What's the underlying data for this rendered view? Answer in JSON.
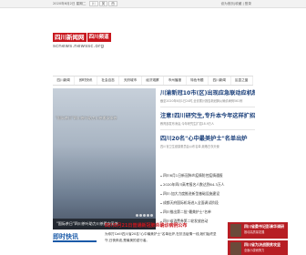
{
  "topbar": {
    "date": "2020年6月2日 星期二",
    "tabs": [
      "川",
      "英",
      "西"
    ],
    "right_text": "设为首页|收藏 | 登录"
  },
  "logo": {
    "badge": "四川新闻网",
    "badge2": "四川频道",
    "domain": "scnews.newssc.org"
  },
  "nav": {
    "items": [
      "四川新闻",
      "即时快讯",
      "社会百态",
      "天府城市",
      "经济观察",
      "市州播报",
      "特色专题",
      "四川新闻",
      "区县之窗"
    ]
  },
  "slider": {
    "caption_top": "\"国际茶日\"四川茶叶助力川茶雅安采茶",
    "caption_bottom": "\"国际茶日\"四川茶叶助力川茶雅安采茶",
    "dots": 5
  },
  "headlines": [
    {
      "title": "川渝新冠10市(区)出现应急联动应机制",
      "summary": "截至2020年6月1日24时,全省累计报告新冠肺炎确诊病例561例"
    },
    {
      "title": "注意!四川研究生,专升本今年这样扩招",
      "summary": "教育部发布消息,今年研究生扩招18.9万人"
    },
    {
      "title": "四川20名\"心中最美护士\"名单出炉",
      "summary": "四川省卫生健康委员会公布名单,致敬白衣天使"
    }
  ],
  "news_list": [
    "四川6月1日新冠肺炎疫情防控疫情通报",
    "2020年四川高考报名人数达到64.3万人",
    "四川:加大力度推进新型基础设施建设",
    "成都天府国际机场进入全面调试阶段",
    "四川推出第二批\"最美护士\"名单",
    "四川省消费券第二轮发放启动"
  ],
  "section2": {
    "title": "即时快讯"
  },
  "feature": {
    "title": "四川5月21日普通新冠肺炎确诊病例公布",
    "body": "为你打Call!四川省20名\"心中最美护士\"名单出炉,在抗击疫情一线,她们始终坚守,日夜奔波,是最美的逆行者。"
  },
  "ads": [
    {
      "title": "四川省委书记彭清华调研",
      "sub": "推动高质量发展"
    },
    {
      "title": "四川省为决战脱贫攻坚",
      "sub": "全面小康而努力"
    }
  ],
  "colors": {
    "brand_red": "#c8161d",
    "headline_blue": "#1a3f7a",
    "section_blue": "#1a5aa8"
  }
}
